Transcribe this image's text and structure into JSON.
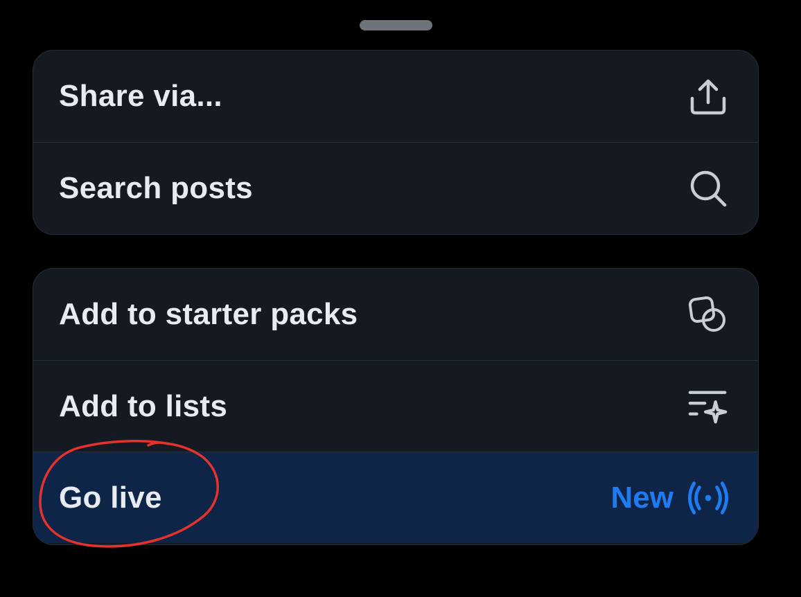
{
  "sheet": {
    "group1": {
      "items": [
        {
          "label": "Share via...",
          "icon": "share-upload-icon"
        },
        {
          "label": "Search posts",
          "icon": "search-icon"
        }
      ]
    },
    "group2": {
      "items": [
        {
          "label": "Add to starter packs",
          "icon": "starter-pack-icon"
        },
        {
          "label": "Add to lists",
          "icon": "list-sparkle-icon"
        },
        {
          "label": "Go live",
          "badge": "New",
          "icon": "live-broadcast-icon"
        }
      ]
    }
  },
  "colors": {
    "background": "#000000",
    "sheet_surface": "#141922",
    "highlight_row": "#0e2547",
    "accent_blue": "#1f7bf2",
    "text": "#e8ecf2",
    "icon": "#c9ced6",
    "annotation_red": "#e5322d"
  }
}
